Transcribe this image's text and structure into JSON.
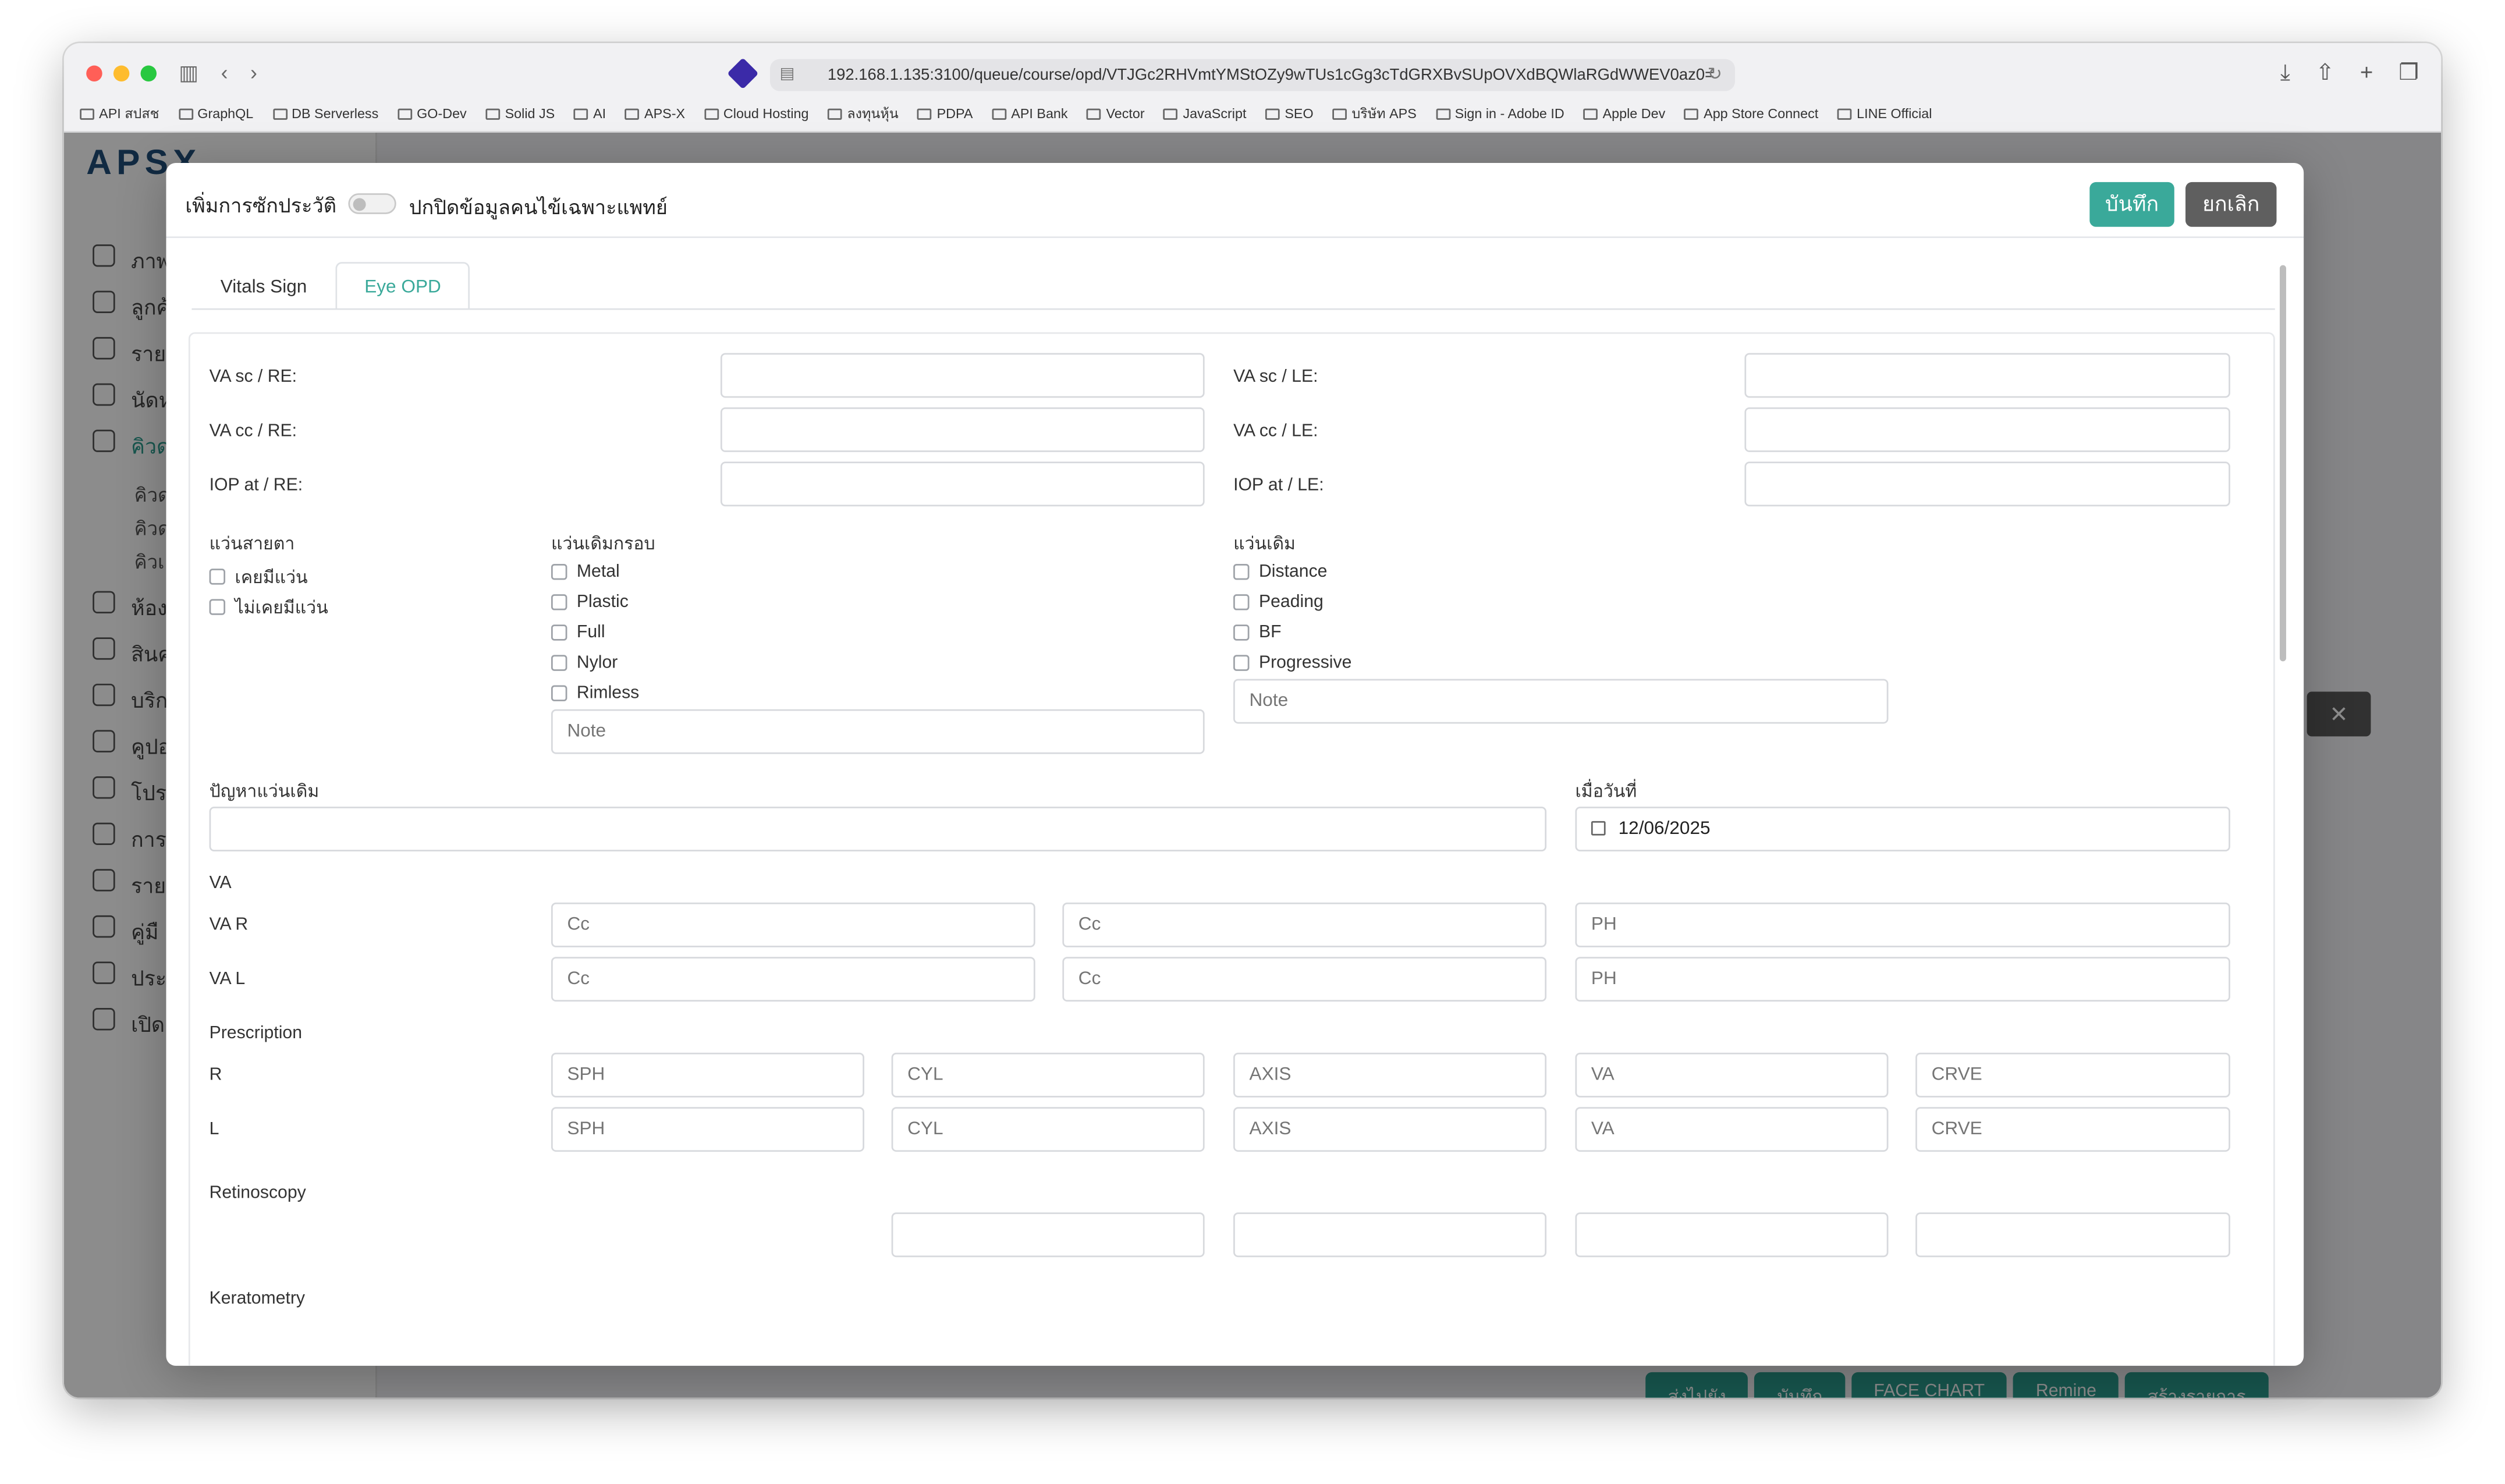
{
  "browser": {
    "url": "192.168.1.135:3100/queue/course/opd/VTJGc2RHVmtYMStOZy9wTUs1cGg3cTdGRXBvSUpOVXdBQWlaRGdWWEV0az0=",
    "bookmarks": [
      "API สปสช",
      "GraphQL",
      "DB Serverless",
      "GO-Dev",
      "Solid JS",
      "AI",
      "APS-X",
      "Cloud Hosting",
      "ลงทุนหุ้น",
      "PDPA",
      "API Bank",
      "Vector",
      "JavaScript",
      "SEO",
      "บริษัท APS",
      "Sign in - Adobe ID",
      "Apple Dev",
      "App Store Connect",
      "LINE Official"
    ]
  },
  "background": {
    "logo": "APSX",
    "sidebar_items": [
      "ภาพ",
      "ลูกค้",
      "ราย",
      "นัดห",
      "คิวด",
      "ห้อง",
      "สินค",
      "บริก",
      "คูปอ",
      "โปร",
      "การ",
      "ราย",
      "คู่มื",
      "ประ",
      "เปิด"
    ],
    "sidebar_sub": [
      "คิวด",
      "คิวด",
      "คิวเ"
    ],
    "bottom_buttons": [
      "ส่งไปยัง",
      "บันทึก",
      "FACE CHART",
      "Remine",
      "สร้างรายการ"
    ]
  },
  "modal": {
    "title": "เพิ่มการซักประวัติ",
    "toggle_label": "ปกปิดข้อมูลคนไข้เฉพาะแพทย์",
    "save_label": "บันทึก",
    "cancel_label": "ยกเลิก",
    "tabs": [
      "Vitals Sign",
      "Eye OPD"
    ],
    "active_tab": "Eye OPD"
  },
  "eye_opd": {
    "va_sc_re": "VA sc / RE:",
    "va_cc_re": "VA cc / RE:",
    "iop_re": "IOP at / RE:",
    "va_sc_le": "VA sc / LE:",
    "va_cc_le": "VA cc / LE:",
    "iop_le": "IOP at / LE:",
    "glasses_group": {
      "title": "แว่นสายตา",
      "options": [
        "เคยมีแว่น",
        "ไม่เคยมีแว่น"
      ]
    },
    "frame_group": {
      "title": "แว่นเดิมกรอบ",
      "options": [
        "Metal",
        "Plastic",
        "Full",
        "Nylor",
        "Rimless"
      ],
      "note_placeholder": "Note"
    },
    "old_glasses_group": {
      "title": "แว่นเดิม",
      "options": [
        "Distance",
        "Peading",
        "BF",
        "Progressive"
      ],
      "note_placeholder": "Note"
    },
    "problem_label": "ปัญหาแว่นเดิม",
    "date_label": "เมื่อวันที่",
    "date_value": "12/06/2025",
    "va_section": "VA",
    "va_r_label": "VA R",
    "va_l_label": "VA L",
    "va_placeholders": [
      "Cc",
      "Cc",
      "PH"
    ],
    "prescription_label": "Prescription",
    "rx_r_label": "R",
    "rx_l_label": "L",
    "rx_placeholders": [
      "SPH",
      "CYL",
      "AXIS",
      "VA",
      "CRVE"
    ],
    "retinoscopy_label": "Retinoscopy",
    "keratometry_label": "Keratometry"
  },
  "colors": {
    "accent": "#3aa99a",
    "cancel": "#5f5f5f"
  }
}
